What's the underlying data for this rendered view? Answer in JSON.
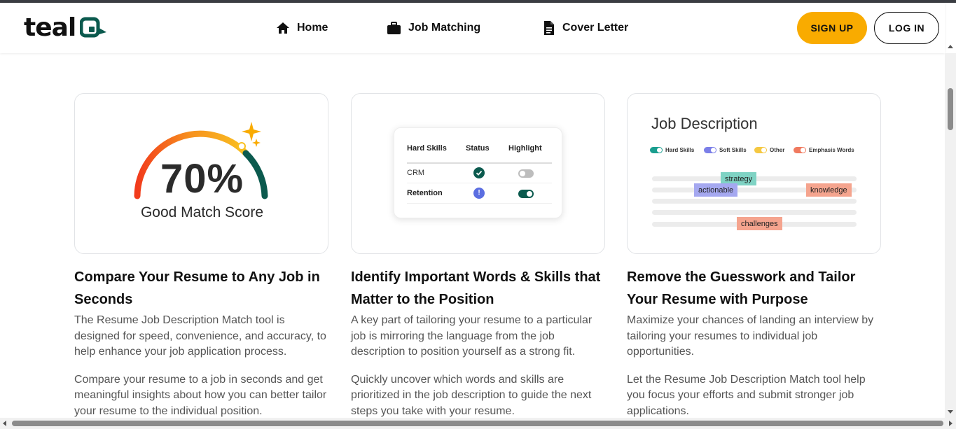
{
  "header": {
    "logo": "teal",
    "nav": [
      {
        "label": "Home",
        "icon": "home-icon"
      },
      {
        "label": "Job Matching",
        "icon": "briefcase-icon"
      },
      {
        "label": "Cover Letter",
        "icon": "document-icon"
      }
    ],
    "signup_label": "SIGN UP",
    "login_label": "LOG IN"
  },
  "cards": {
    "score": {
      "value": "70%",
      "caption": "Good Match Score"
    },
    "skills_table": {
      "headers": [
        "Hard Skills",
        "Status",
        "Highlight"
      ],
      "rows": [
        {
          "skill": "CRM",
          "status": "matched",
          "highlight": false
        },
        {
          "skill": "Retention",
          "status": "missing",
          "highlight": true
        }
      ]
    },
    "job_description": {
      "title": "Job Description",
      "legend": [
        {
          "label": "Hard Skills",
          "color": "#1a9e8f"
        },
        {
          "label": "Soft Skills",
          "color": "#7b7fe8"
        },
        {
          "label": "Other",
          "color": "#f5c842"
        },
        {
          "label": "Emphasis Words",
          "color": "#f07a5f"
        }
      ],
      "tags": {
        "strategy": "strategy",
        "actionable": "actionable",
        "knowledge": "knowledge",
        "challenges": "challenges"
      }
    }
  },
  "columns": [
    {
      "title": "Compare Your Resume to Any Job in Seconds",
      "p1": "The Resume Job Description Match tool is designed for speed, convenience, and accuracy, to help enhance your job application process.",
      "p2": "Compare your resume to a job in seconds and get meaningful insights about how you can better tailor your resume to the individual position."
    },
    {
      "title": "Identify Important Words & Skills that Matter to the Position",
      "p1": "A key part of tailoring your resume to a particular job is mirroring the language from the job description to position yourself as a strong fit.",
      "p2": "Quickly uncover which words and skills are prioritized in the job description to guide the next steps you take with your resume."
    },
    {
      "title": "Remove the Guesswork and Tailor Your Resume with Purpose",
      "p1": "Maximize your chances of landing an interview by tailoring your resumes to individual job opportunities.",
      "p2": "Let the Resume Job Description Match tool help you focus your efforts and submit stronger job applications."
    }
  ],
  "colors": {
    "accent": "#f9ab00",
    "brand": "#0b5a4e"
  }
}
